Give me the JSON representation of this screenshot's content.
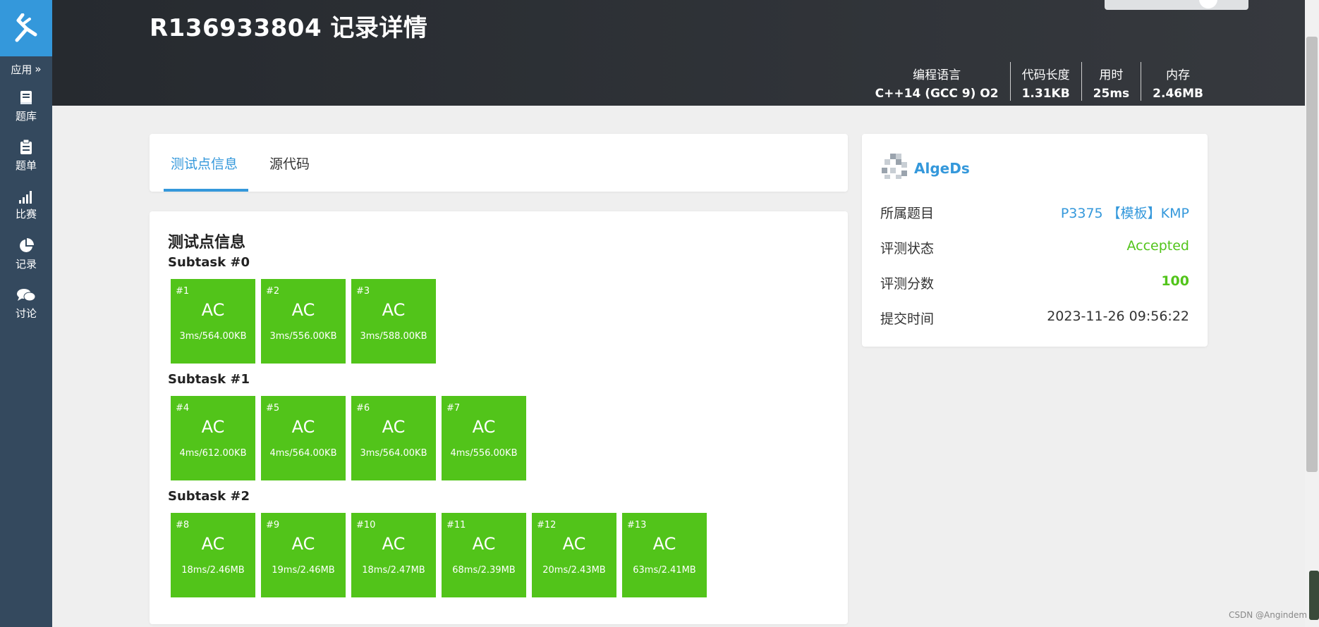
{
  "app": {
    "accent_color": "#3498db",
    "success_color": "#52c41a",
    "sidebar_color": "#34495e"
  },
  "sidebar": {
    "app_toggle_label": "应用",
    "items": [
      {
        "label": "题库",
        "icon": "book-icon"
      },
      {
        "label": "题单",
        "icon": "clipboard-icon"
      },
      {
        "label": "比赛",
        "icon": "signal-bars-icon"
      },
      {
        "label": "记录",
        "icon": "pie-chart-icon"
      },
      {
        "label": "讨论",
        "icon": "chat-bubbles-icon"
      }
    ]
  },
  "header": {
    "title": "R136933804 记录详情",
    "stats": [
      {
        "label": "编程语言",
        "value": "C++14 (GCC 9) O2"
      },
      {
        "label": "代码长度",
        "value": "1.31KB"
      },
      {
        "label": "用时",
        "value": "25ms"
      },
      {
        "label": "内存",
        "value": "2.46MB"
      }
    ]
  },
  "tabs": [
    {
      "label": "测试点信息",
      "active": true
    },
    {
      "label": "源代码",
      "active": false
    }
  ],
  "tests": {
    "section_title": "测试点信息",
    "subtasks": [
      {
        "title": "Subtask #0",
        "cases": [
          {
            "id": "#1",
            "status": "AC",
            "info": "3ms/564.00KB"
          },
          {
            "id": "#2",
            "status": "AC",
            "info": "3ms/556.00KB"
          },
          {
            "id": "#3",
            "status": "AC",
            "info": "3ms/588.00KB"
          }
        ]
      },
      {
        "title": "Subtask #1",
        "cases": [
          {
            "id": "#4",
            "status": "AC",
            "info": "4ms/612.00KB"
          },
          {
            "id": "#5",
            "status": "AC",
            "info": "4ms/564.00KB"
          },
          {
            "id": "#6",
            "status": "AC",
            "info": "3ms/564.00KB"
          },
          {
            "id": "#7",
            "status": "AC",
            "info": "4ms/556.00KB"
          }
        ]
      },
      {
        "title": "Subtask #2",
        "cases": [
          {
            "id": "#8",
            "status": "AC",
            "info": "18ms/2.46MB"
          },
          {
            "id": "#9",
            "status": "AC",
            "info": "19ms/2.46MB"
          },
          {
            "id": "#10",
            "status": "AC",
            "info": "18ms/2.47MB"
          },
          {
            "id": "#11",
            "status": "AC",
            "info": "68ms/2.39MB"
          },
          {
            "id": "#12",
            "status": "AC",
            "info": "20ms/2.43MB"
          },
          {
            "id": "#13",
            "status": "AC",
            "info": "63ms/2.41MB"
          }
        ]
      }
    ]
  },
  "info": {
    "user_name": "AlgeDs",
    "rows": [
      {
        "label": "所属题目",
        "value": "P3375 【模板】KMP"
      },
      {
        "label": "评测状态",
        "value": "Accepted"
      },
      {
        "label": "评测分数",
        "value": "100"
      },
      {
        "label": "提交时间",
        "value": "2023-11-26 09:56:22"
      }
    ]
  },
  "watermark": "CSDN @Angindem"
}
